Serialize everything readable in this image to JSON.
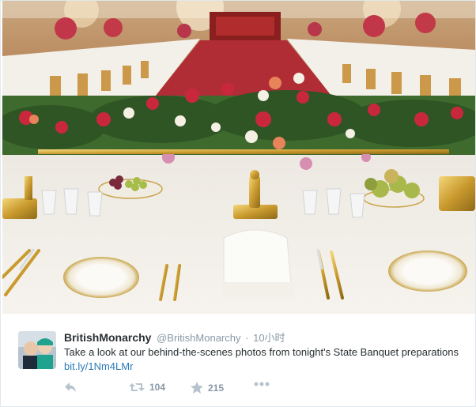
{
  "tweet": {
    "display_name": "BritishMonarchy",
    "handle": "@BritishMonarchy",
    "separator": "·",
    "time": "10小时",
    "text_before_link": "Take a look at our behind-the-scenes photos from tonight's State Banquet preparations ",
    "link": "bit.ly/1Nm4LMr",
    "retweets": "104",
    "favorites": "215"
  },
  "icons": {
    "reply": "reply-icon",
    "retweet": "retweet-icon",
    "favorite": "star-icon",
    "more": "more-icon"
  },
  "colors": {
    "name": "#292f33",
    "meta": "#8899a6",
    "link": "#2b7bb9",
    "action": "#8899a6"
  }
}
